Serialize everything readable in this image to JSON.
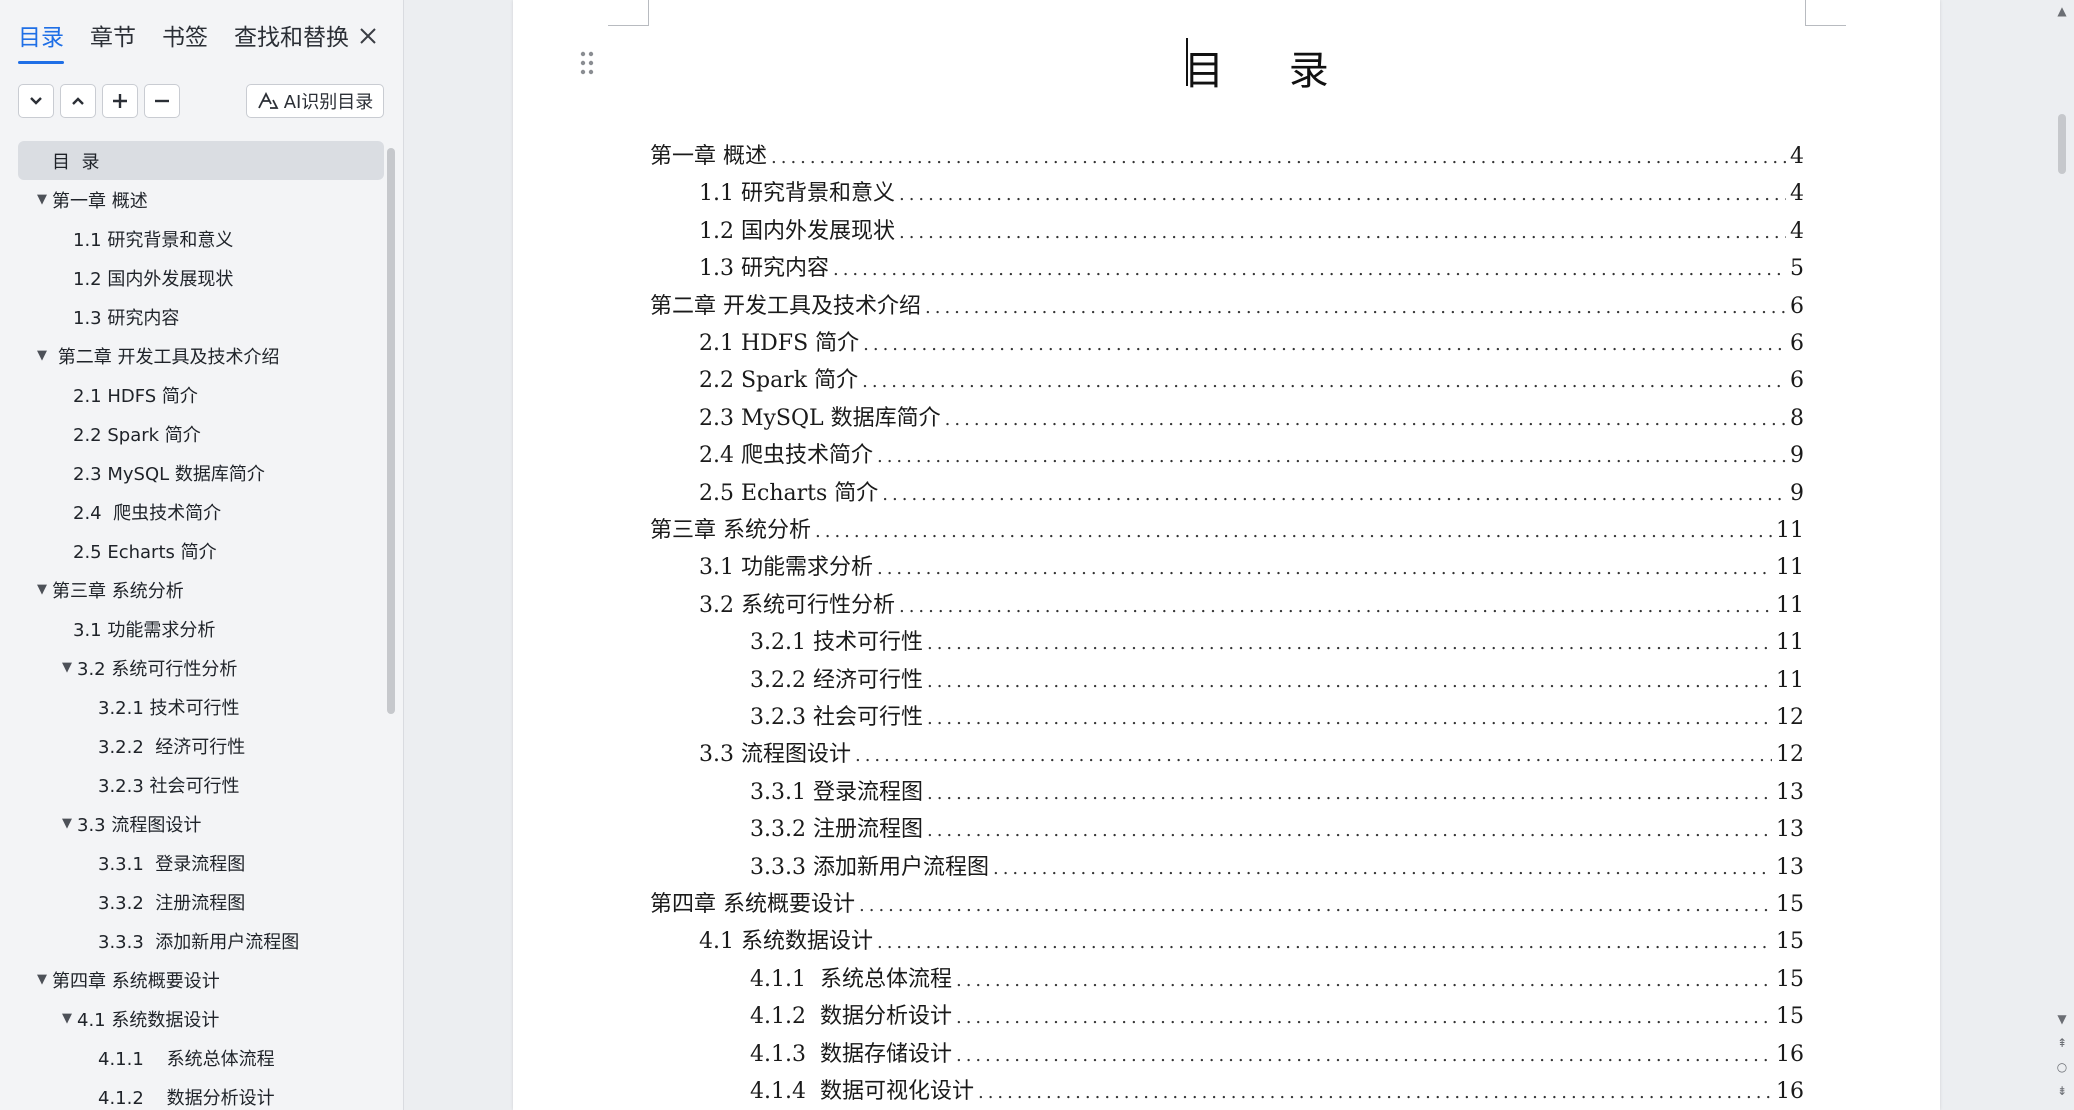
{
  "left_panel": {
    "tabs": [
      {
        "label": "目录",
        "active": true
      },
      {
        "label": "章节",
        "active": false
      },
      {
        "label": "书签",
        "active": false
      },
      {
        "label": "查找和替换",
        "active": false
      }
    ],
    "ai_button_label": "AI识别目录",
    "tree": [
      {
        "label": "目  录",
        "level": 0,
        "arrow": "",
        "selected": true
      },
      {
        "label": "第一章 概述",
        "level": 0,
        "arrow": "▼"
      },
      {
        "label": "1.1 研究背景和意义",
        "level": 1,
        "arrow": ""
      },
      {
        "label": "1.2 国内外发展现状",
        "level": 1,
        "arrow": ""
      },
      {
        "label": "1.3 研究内容",
        "level": 1,
        "arrow": ""
      },
      {
        "label": " 第二章 开发工具及技术介绍",
        "level": 0,
        "arrow": "▼"
      },
      {
        "label": "2.1 HDFS 简介",
        "level": 1,
        "arrow": ""
      },
      {
        "label": "2.2 Spark 简介",
        "level": 1,
        "arrow": ""
      },
      {
        "label": "2.3 MySQL 数据库简介",
        "level": 1,
        "arrow": ""
      },
      {
        "label": "2.4  爬虫技术简介",
        "level": 1,
        "arrow": ""
      },
      {
        "label": "2.5 Echarts 简介",
        "level": 1,
        "arrow": ""
      },
      {
        "label": "第三章 系统分析",
        "level": 0,
        "arrow": "▼"
      },
      {
        "label": "3.1 功能需求分析",
        "level": 1,
        "arrow": ""
      },
      {
        "label": "3.2 系统可行性分析",
        "level": 1,
        "arrow": "▼"
      },
      {
        "label": "3.2.1 技术可行性",
        "level": 2,
        "arrow": ""
      },
      {
        "label": "3.2.2  经济可行性",
        "level": 2,
        "arrow": ""
      },
      {
        "label": "3.2.3 社会可行性",
        "level": 2,
        "arrow": ""
      },
      {
        "label": "3.3 流程图设计",
        "level": 1,
        "arrow": "▼"
      },
      {
        "label": "3.3.1  登录流程图",
        "level": 2,
        "arrow": ""
      },
      {
        "label": "3.3.2  注册流程图",
        "level": 2,
        "arrow": ""
      },
      {
        "label": "3.3.3  添加新用户流程图",
        "level": 2,
        "arrow": ""
      },
      {
        "label": "第四章 系统概要设计",
        "level": 0,
        "arrow": "▼"
      },
      {
        "label": "4.1 系统数据设计",
        "level": 1,
        "arrow": "▼"
      },
      {
        "label": "4.1.1    系统总体流程",
        "level": 2,
        "arrow": ""
      },
      {
        "label": "4.1.2    数据分析设计",
        "level": 2,
        "arrow": ""
      }
    ]
  },
  "document": {
    "title": "目 录",
    "toc": [
      {
        "text": "第一章 概述",
        "page": "4",
        "indent": 0
      },
      {
        "text": "1.1 研究背景和意义",
        "page": "4",
        "indent": 1
      },
      {
        "text": "1.2 国内外发展现状",
        "page": "4",
        "indent": 1
      },
      {
        "text": "1.3 研究内容",
        "page": "5",
        "indent": 1
      },
      {
        "text": "第二章 开发工具及技术介绍",
        "page": "6",
        "indent": 0
      },
      {
        "text": "2.1 HDFS 简介",
        "page": "6",
        "indent": 1
      },
      {
        "text": "2.2 Spark 简介",
        "page": "6",
        "indent": 1
      },
      {
        "text": "2.3 MySQL 数据库简介",
        "page": "8",
        "indent": 1
      },
      {
        "text": "2.4 爬虫技术简介",
        "page": "9",
        "indent": 1
      },
      {
        "text": "2.5 Echarts 简介",
        "page": "9",
        "indent": 1
      },
      {
        "text": "第三章 系统分析",
        "page": "11",
        "indent": 0
      },
      {
        "text": "3.1 功能需求分析",
        "page": "11",
        "indent": 1
      },
      {
        "text": "3.2 系统可行性分析",
        "page": "11",
        "indent": 1
      },
      {
        "text": "3.2.1 技术可行性",
        "page": "11",
        "indent": 2
      },
      {
        "text": "3.2.2 经济可行性",
        "page": "11",
        "indent": 2
      },
      {
        "text": "3.2.3 社会可行性",
        "page": "12",
        "indent": 2
      },
      {
        "text": "3.3 流程图设计",
        "page": "12",
        "indent": 1
      },
      {
        "text": "3.3.1 登录流程图",
        "page": "13",
        "indent": 2
      },
      {
        "text": "3.3.2 注册流程图",
        "page": "13",
        "indent": 2
      },
      {
        "text": "3.3.3 添加新用户流程图",
        "page": "13",
        "indent": 2
      },
      {
        "text": "第四章 系统概要设计",
        "page": "15",
        "indent": 0
      },
      {
        "text": "4.1 系统数据设计",
        "page": "15",
        "indent": 1
      },
      {
        "text": "4.1.1  系统总体流程",
        "page": "15",
        "indent": 2
      },
      {
        "text": "4.1.2  数据分析设计",
        "page": "15",
        "indent": 2
      },
      {
        "text": "4.1.3  数据存储设计",
        "page": "16",
        "indent": 2
      },
      {
        "text": "4.1.4  数据可视化设计",
        "page": "16",
        "indent": 2
      }
    ]
  },
  "colors": {
    "accent": "#1f6fe6",
    "panel_bg": "#f3f4f6",
    "selected_bg": "#dadde2"
  },
  "icons": [
    "close-icon",
    "collapse-down-icon",
    "expand-up-icon",
    "plus-icon",
    "minus-icon",
    "ai-icon",
    "drag-handle-icon"
  ]
}
